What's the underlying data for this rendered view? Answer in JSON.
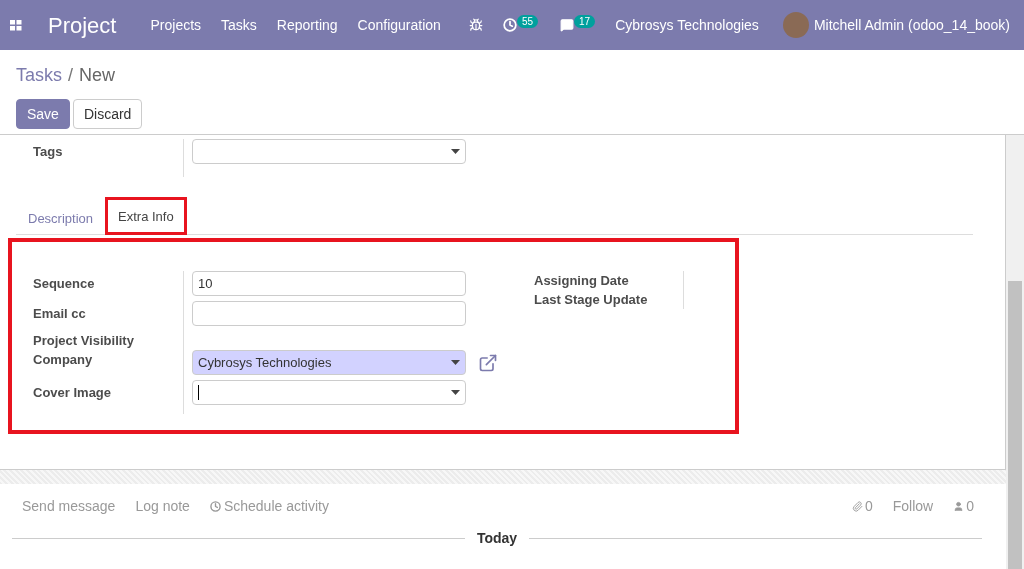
{
  "navbar": {
    "app_name": "Project",
    "menu": [
      "Projects",
      "Tasks",
      "Reporting",
      "Configuration"
    ],
    "activity_count": "55",
    "message_count": "17",
    "company": "Cybrosys Technologies",
    "user": "Mitchell Admin (odoo_14_book)"
  },
  "breadcrumb": {
    "parent": "Tasks",
    "separator": "/",
    "current": "New"
  },
  "buttons": [
    {
      "label": "Save",
      "kind": "primary"
    },
    {
      "label": "Discard",
      "kind": "secondary"
    }
  ],
  "tags": {
    "label": "Tags"
  },
  "tabs": [
    {
      "label": "Description",
      "selected": false,
      "highlighted": false
    },
    {
      "label": "Extra Info",
      "selected": true,
      "highlighted": true
    }
  ],
  "extra_info": {
    "highlighted": true,
    "fields": [
      {
        "label": "Sequence",
        "kind": "text",
        "value": "10"
      },
      {
        "label": "Email cc",
        "kind": "text"
      },
      {
        "label": "Project Visibility",
        "kind": "none"
      },
      {
        "label": "Company",
        "kind": "select",
        "value": "Cybrosys Technologies",
        "required": true,
        "external_link": true
      },
      {
        "label": "Cover Image",
        "kind": "select",
        "focused": true
      }
    ],
    "side_labels": [
      "Assigning Date",
      "Last Stage Update"
    ]
  },
  "chatter": {
    "actions": [
      {
        "label": "Send message",
        "kind": "plain"
      },
      {
        "label": "Log note",
        "kind": "plain"
      },
      {
        "label": "Schedule activity",
        "kind": "activity"
      }
    ],
    "attachments": "0",
    "follow": "Follow",
    "followers": "0",
    "date_divider": "Today"
  }
}
